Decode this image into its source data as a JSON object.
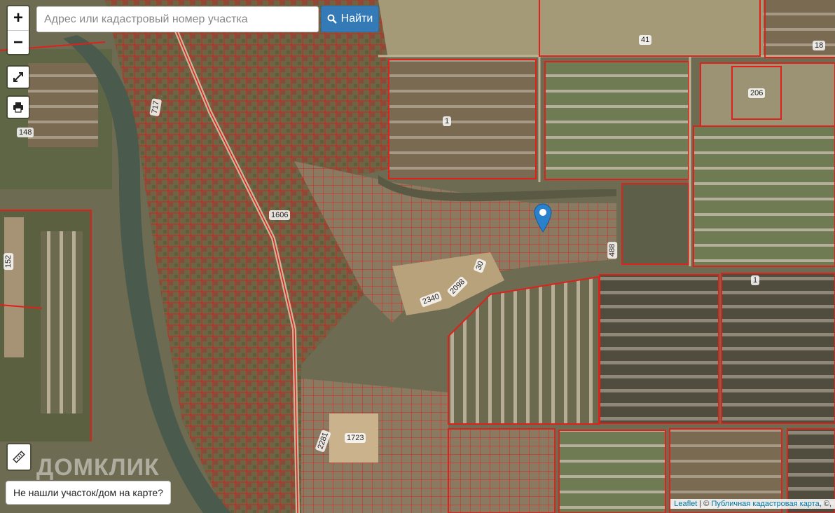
{
  "search": {
    "placeholder": "Адрес или кадастровый номер участка",
    "button_label": "Найти"
  },
  "controls": {
    "zoom_in": "+",
    "zoom_out": "−",
    "fullscreen_icon": "expand-icon",
    "print_icon": "printer-icon",
    "ruler_icon": "ruler-icon"
  },
  "not_found_button": "Не нашли участок/дом на карте?",
  "watermark": "ДОМКЛИК",
  "attribution": {
    "leaflet": "Leaflet",
    "separator": " | © ",
    "source": "Публичная кадастровая карта",
    "suffix": ", ©,"
  },
  "parcel_labels": {
    "p1": "41",
    "p2": "18",
    "p3": "206",
    "p4": "1",
    "p5": "148",
    "p6": "717",
    "p7": "1606",
    "p8": "488",
    "p9": "1",
    "p10": "30",
    "p11": "2098",
    "p12": "2340",
    "p13": "152",
    "p14": "2281",
    "p15": "1723"
  },
  "colors": {
    "parcel_outline": "#e0201a",
    "search_button": "#337ab7",
    "attribution_link": "#0078a8"
  }
}
